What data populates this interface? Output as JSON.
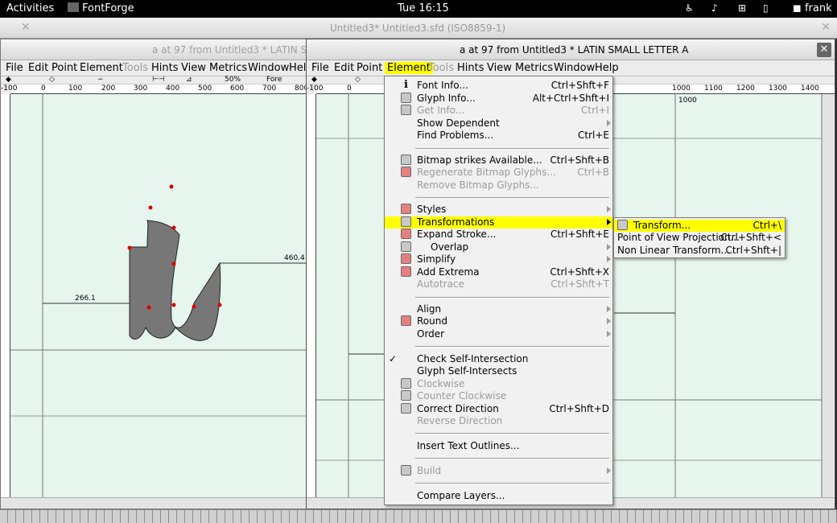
{
  "topbar": {
    "activities": "Activities",
    "app": "FontForge",
    "clock": "Tue 16:15",
    "user": "frank"
  },
  "background_window": {
    "title": "Untitled3*  Untitled3.sfd (ISO8859-1)"
  },
  "left_window": {
    "title": "a at 97 from Untitled3 * LATIN S",
    "menu": [
      "File",
      "Edit",
      "Point",
      "Element",
      "Tools",
      "Hints",
      "View",
      "Metrics",
      "Window",
      "Help"
    ],
    "toolbar": {
      "zoom": "50%",
      "layer": "Fore"
    },
    "ruler_labels": [
      "-100",
      "0",
      "100",
      "200",
      "300",
      "400",
      "500",
      "600",
      "700",
      "800"
    ],
    "measure_left": "266.1",
    "measure_right": "460.4"
  },
  "right_window": {
    "title": "a at 97 from Untitled3 * LATIN SMALL LETTER A",
    "menu": [
      "File",
      "Edit",
      "Point",
      "Element",
      "Tools",
      "Hints",
      "View",
      "Metrics",
      "Window",
      "Help"
    ],
    "ruler_labels": [
      "-100",
      "0",
      "1000",
      "1100",
      "1200",
      "1300",
      "1400"
    ],
    "advance_label": "1000"
  },
  "element_menu": {
    "items": [
      {
        "label": "Font Info...",
        "shortcut": "Ctrl+Shft+F",
        "icon": "info-icon"
      },
      {
        "label": "Glyph Info...",
        "shortcut": "Alt+Ctrl+Shft+I",
        "icon": "glyph-info-icon"
      },
      {
        "label": "Get Info...",
        "shortcut": "Ctrl+I",
        "icon": "get-info-icon"
      },
      {
        "label": "Show Dependent"
      },
      {
        "label": "Find Problems...",
        "shortcut": "Ctrl+E"
      },
      {
        "label": "Bitmap strikes Available...",
        "shortcut": "Ctrl+Shft+B",
        "icon": "bitmap-icon"
      },
      {
        "label": "Regenerate Bitmap Glyphs...",
        "shortcut": "Ctrl+B",
        "icon": "regenerate-icon"
      },
      {
        "label": "Remove Bitmap Glyphs..."
      },
      {
        "label": "Styles",
        "icon": "styles-icon"
      },
      {
        "label": "Transformations",
        "icon": "transform-icon"
      },
      {
        "label": "Expand Stroke...",
        "shortcut": "Ctrl+Shft+E",
        "icon": "expand-stroke-icon"
      },
      {
        "label": "Overlap",
        "icon": "overlap-icon"
      },
      {
        "label": "Simplify",
        "icon": "simplify-icon"
      },
      {
        "label": "Add Extrema",
        "shortcut": "Ctrl+Shft+X",
        "icon": "extrema-icon"
      },
      {
        "label": "Autotrace",
        "shortcut": "Ctrl+Shft+T"
      },
      {
        "label": "Align"
      },
      {
        "label": "Round",
        "icon": "round-icon"
      },
      {
        "label": "Order"
      },
      {
        "label": "Check Self-Intersection",
        "check": "✓"
      },
      {
        "label": "Glyph Self-Intersects"
      },
      {
        "label": "Clockwise",
        "icon": "clockwise-icon"
      },
      {
        "label": "Counter Clockwise",
        "icon": "counter-clockwise-icon"
      },
      {
        "label": "Correct Direction",
        "shortcut": "Ctrl+Shft+D",
        "icon": "correct-direction-icon"
      },
      {
        "label": "Reverse Direction"
      },
      {
        "label": "Insert Text Outlines..."
      },
      {
        "label": "Build",
        "icon": "build-icon"
      },
      {
        "label": "Compare Layers..."
      }
    ]
  },
  "transform_submenu": {
    "items": [
      {
        "label": "Transform...",
        "shortcut": "Ctrl+\\"
      },
      {
        "label": "Point of View Projection...",
        "shortcut": "Ctrl+Shft+<"
      },
      {
        "label": "Non Linear Transform...",
        "shortcut": "Ctrl+Shft+|"
      }
    ]
  },
  "colors": {
    "highlight": "#ffff00",
    "canvas": "#e6f5ee",
    "glyph_fill": "#777777",
    "point": "#dd0000"
  }
}
